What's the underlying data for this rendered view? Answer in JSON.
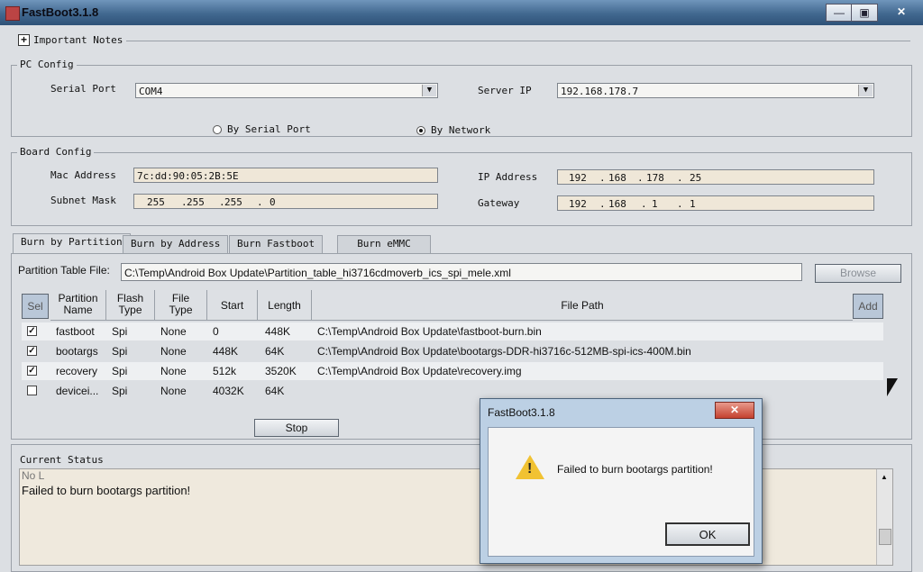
{
  "window": {
    "title": "FastBoot3.1.8",
    "controls": {
      "minimize": "—",
      "maximize": "▣",
      "close": "✕"
    }
  },
  "notes": {
    "expander": "+",
    "label": "Important Notes"
  },
  "pc_config": {
    "legend": "PC Config",
    "serial_port_label": "Serial Port",
    "serial_port_value": "COM4",
    "server_ip_label": "Server IP",
    "server_ip_value": "192.168.178.7",
    "radio_serial_label": "By Serial Port",
    "radio_network_label": "By Network",
    "selected_mode": "By Network"
  },
  "board_config": {
    "legend": "Board Config",
    "mac_label": "Mac Address",
    "mac_value": "7c:dd:90:05:2B:5E",
    "subnet_label": "Subnet Mask",
    "subnet": [
      "255",
      "255",
      "255",
      "0"
    ],
    "ip_label": "IP Address",
    "ip": [
      "192",
      "168",
      "178",
      "25"
    ],
    "gateway_label": "Gateway",
    "gateway": [
      "192",
      "168",
      "1",
      "1"
    ]
  },
  "tabs": [
    "Burn by Partition",
    "Burn by Address",
    "Burn Fastboot",
    "Burn eMMC"
  ],
  "partition": {
    "file_label": "Partition Table File:",
    "file_value": "C:\\Temp\\Android Box Update\\Partition_table_hi3716cdmoverb_ics_spi_mele.xml",
    "browse_label": "Browse",
    "sel_label": "Sel",
    "add_label": "Add",
    "columns": {
      "name": [
        "Partition",
        "Name"
      ],
      "flash": [
        "Flash",
        "Type"
      ],
      "file": [
        "File",
        "Type"
      ],
      "start": "Start",
      "length": "Length",
      "path": "File Path"
    },
    "rows": [
      {
        "checked": true,
        "name": "fastboot",
        "flash": "Spi",
        "file": "None",
        "start": "0",
        "length": "448K",
        "path": "C:\\Temp\\Android Box Update\\fastboot-burn.bin"
      },
      {
        "checked": true,
        "name": "bootargs",
        "flash": "Spi",
        "file": "None",
        "start": "448K",
        "length": "64K",
        "path": "C:\\Temp\\Android Box Update\\bootargs-DDR-hi3716c-512MB-spi-ics-400M.bin"
      },
      {
        "checked": true,
        "name": "recovery",
        "flash": "Spi",
        "file": "None",
        "start": "512k",
        "length": "3520K",
        "path": "C:\\Temp\\Android Box Update\\recovery.img"
      },
      {
        "checked": false,
        "name": "devicei...",
        "flash": "Spi",
        "file": "None",
        "start": "4032K",
        "length": "64K",
        "path": ""
      }
    ],
    "stop_label": "Stop"
  },
  "status": {
    "legend": "Current Status",
    "line1": "No L",
    "line2": "Failed to burn bootargs partition!"
  },
  "dialog": {
    "title": "FastBoot3.1.8",
    "close": "✕",
    "message": "Failed to burn bootargs partition!",
    "icon": "warning-icon",
    "ok_label": "OK"
  }
}
